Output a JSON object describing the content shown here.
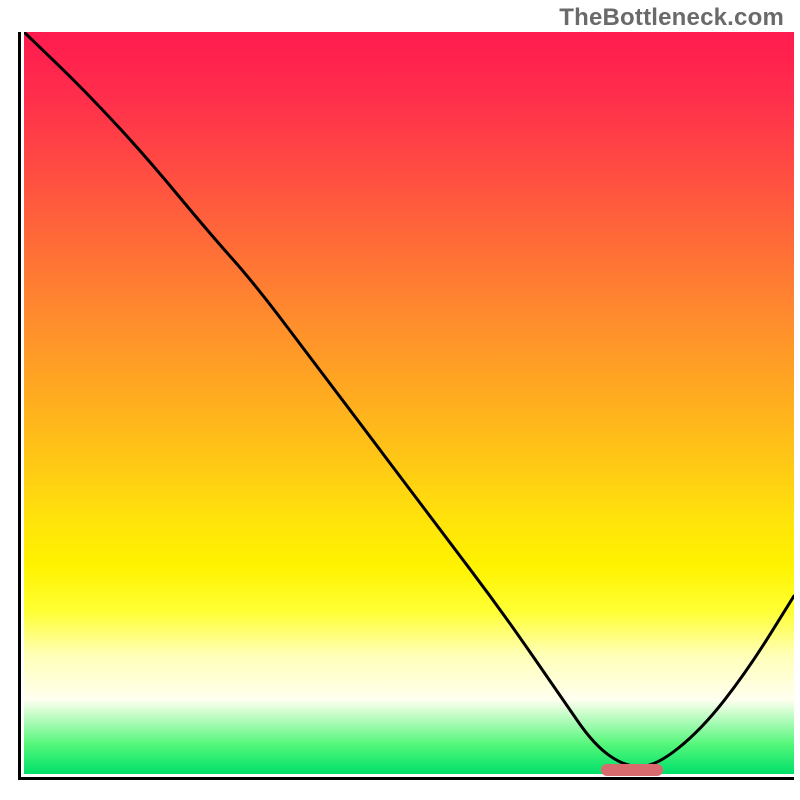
{
  "watermark": "TheBottleneck.com",
  "colors": {
    "axis": "#000000",
    "curve": "#000000",
    "marker": "#d86b6d",
    "watermark": "#6a6a6a"
  },
  "chart_data": {
    "type": "line",
    "title": "",
    "xlabel": "",
    "ylabel": "",
    "xlim": [
      0,
      100
    ],
    "ylim": [
      0,
      100
    ],
    "grid": false,
    "legend": false,
    "gradient_stops": [
      {
        "pos": 0.0,
        "color": "#ff1b4f"
      },
      {
        "pos": 0.08,
        "color": "#ff2c4c"
      },
      {
        "pos": 0.18,
        "color": "#ff4a43"
      },
      {
        "pos": 0.28,
        "color": "#ff6a38"
      },
      {
        "pos": 0.38,
        "color": "#ff8a2e"
      },
      {
        "pos": 0.48,
        "color": "#ffa821"
      },
      {
        "pos": 0.58,
        "color": "#ffc815"
      },
      {
        "pos": 0.66,
        "color": "#ffe40a"
      },
      {
        "pos": 0.72,
        "color": "#fff300"
      },
      {
        "pos": 0.78,
        "color": "#ffff33"
      },
      {
        "pos": 0.84,
        "color": "#ffffb8"
      },
      {
        "pos": 0.9,
        "color": "#fffff0"
      },
      {
        "pos": 0.96,
        "color": "#54f77a"
      },
      {
        "pos": 1.0,
        "color": "#00e06a"
      }
    ],
    "series": [
      {
        "name": "bottleneck-curve",
        "x": [
          0,
          8,
          16,
          24,
          30,
          38,
          46,
          54,
          62,
          70,
          74,
          78,
          82,
          88,
          94,
          100
        ],
        "y": [
          100,
          92,
          83,
          73,
          66,
          55,
          44,
          33,
          22,
          10,
          4,
          1,
          1,
          6,
          14,
          24
        ]
      }
    ],
    "marker": {
      "name": "optimal-range",
      "x_start": 75,
      "x_end": 83,
      "y": 1
    }
  }
}
